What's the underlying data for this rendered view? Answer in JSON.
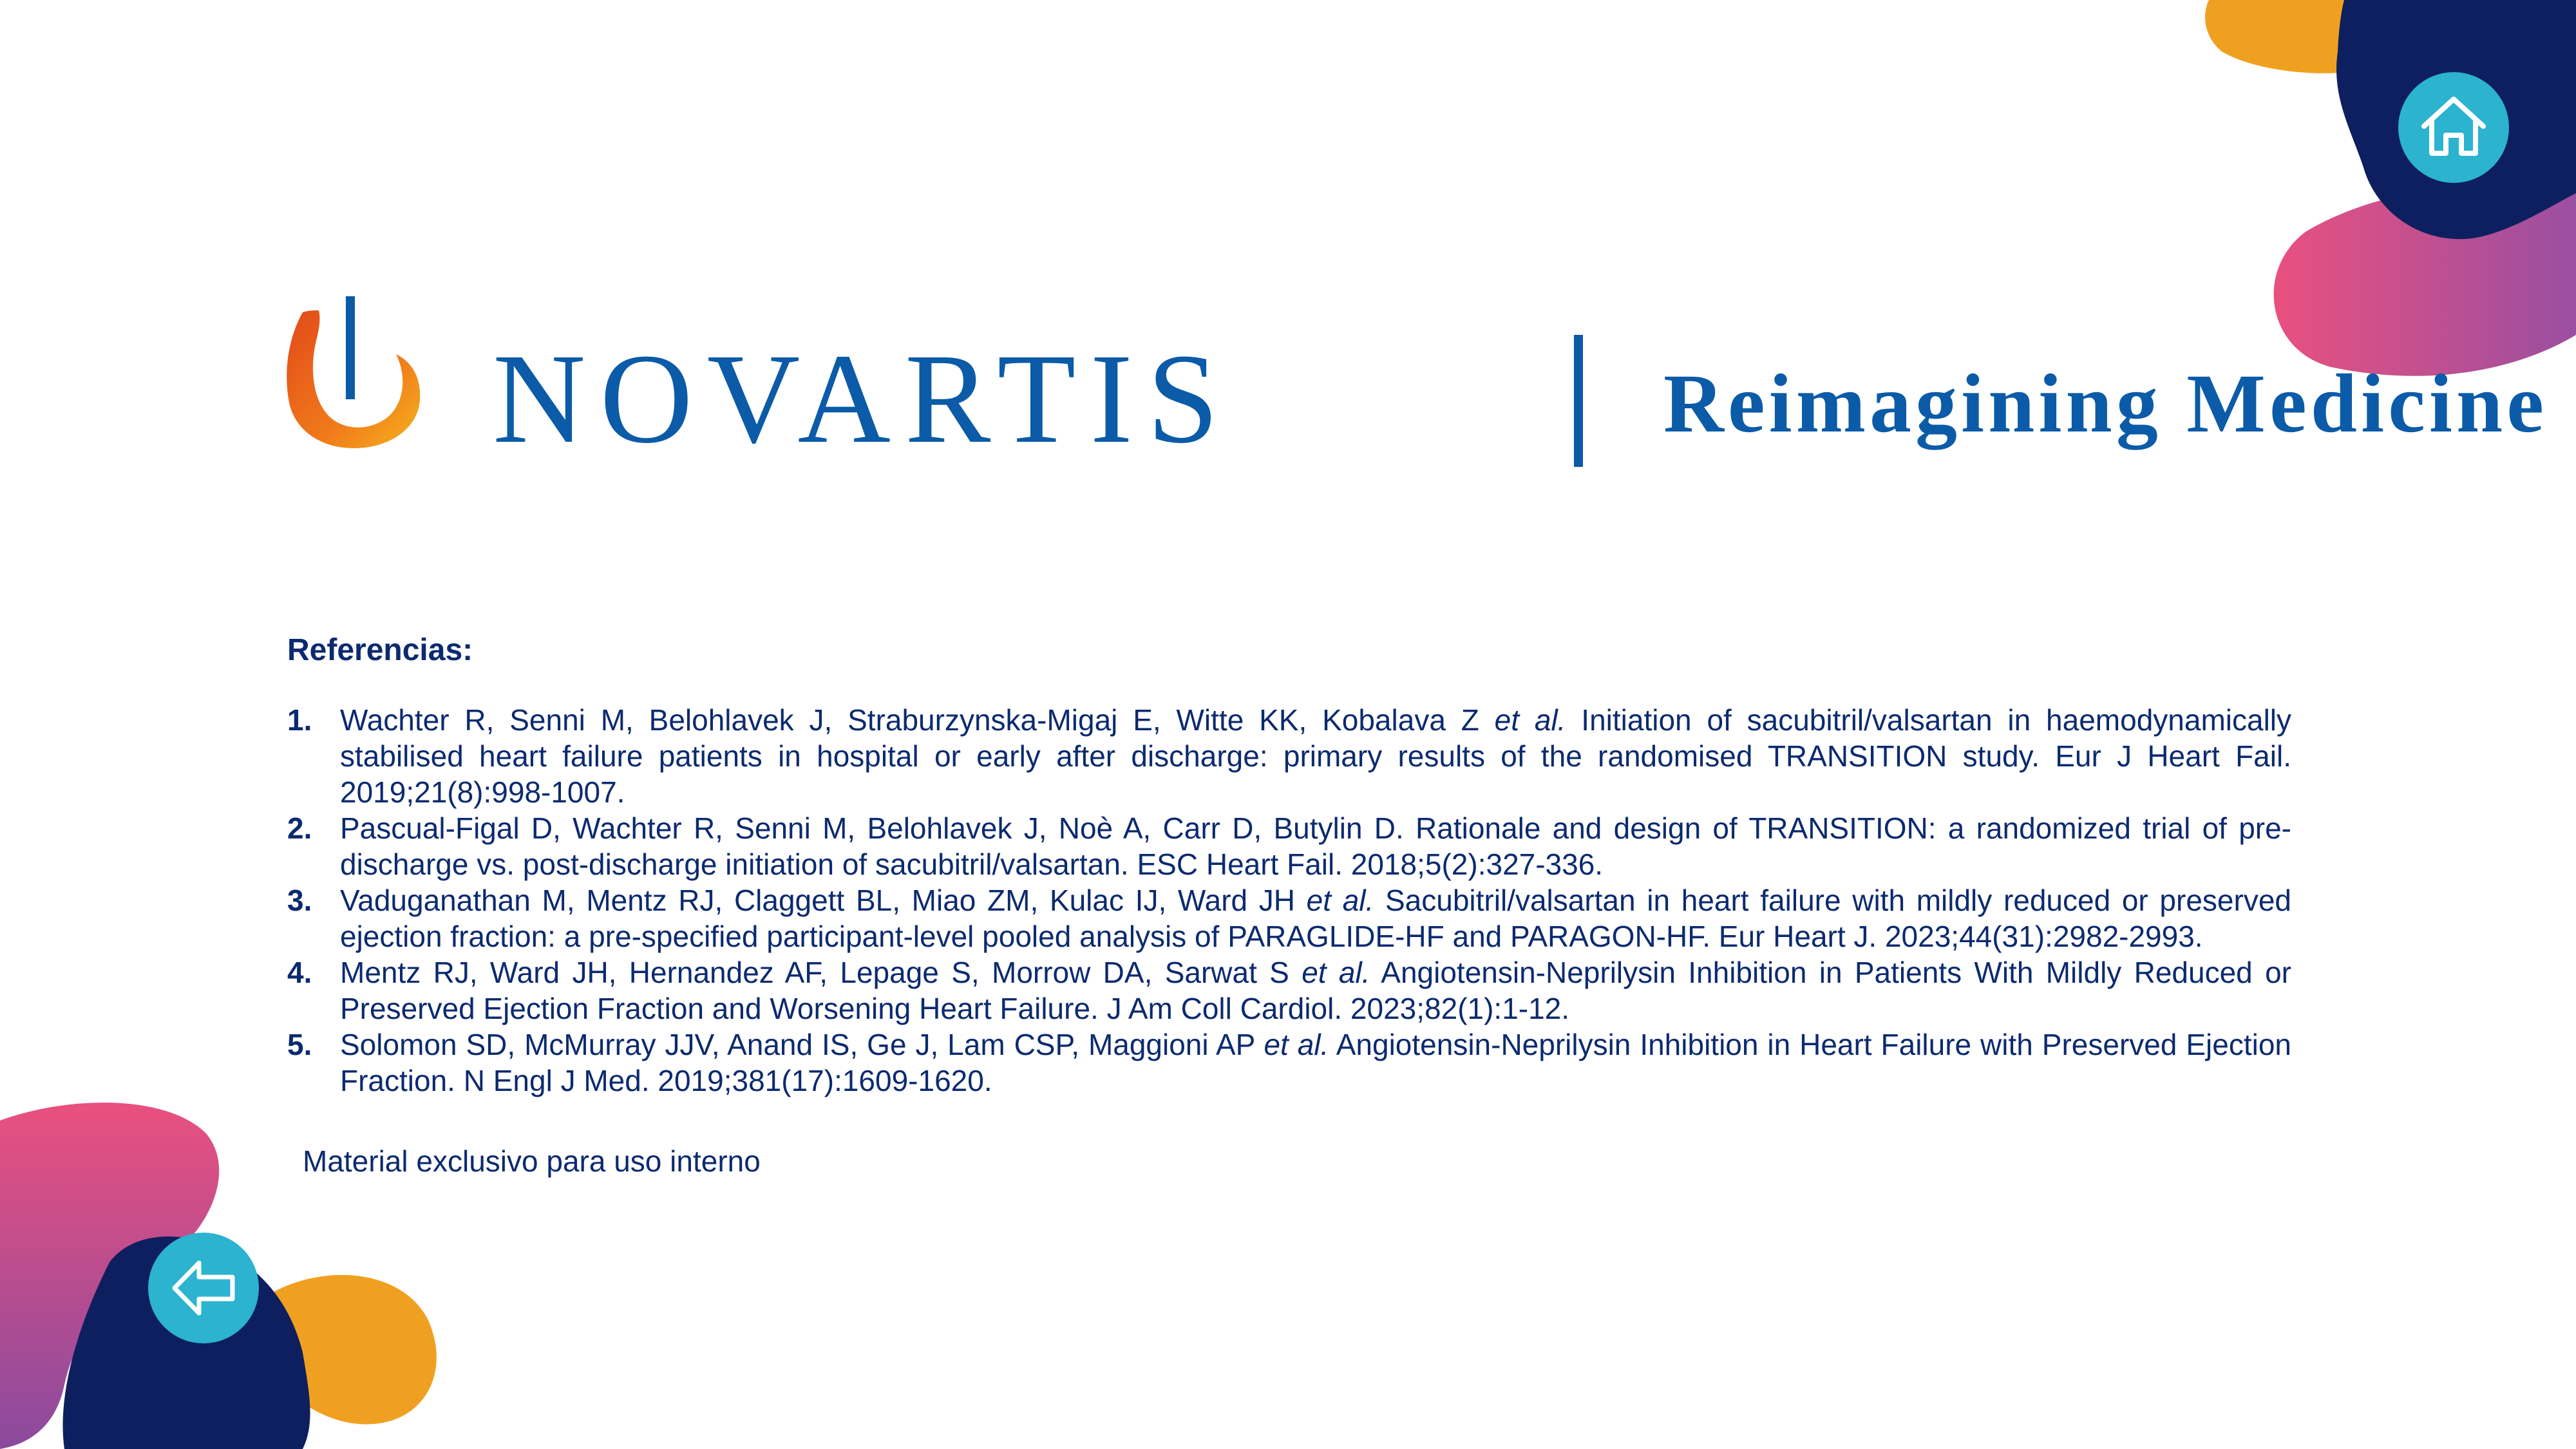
{
  "branding": {
    "wordmark": "NOVARTIS",
    "tagline": "Reimagining Medicine",
    "colors": {
      "primary": "#0b5ba8",
      "text": "#0b2a6f",
      "orange": "#f0a020",
      "pink": "#e9507f",
      "navy": "#0e1f5f",
      "teal": "#2bb3d0"
    }
  },
  "references": {
    "title": "Referencias:",
    "items": [
      {
        "number": "1.",
        "authors": "Wachter R, Senni M, Belohlavek J, Straburzynska-Migaj E, Witte KK, Kobalava Z ",
        "etal": "et al.",
        "text": " Initiation of sacubitril/valsartan in haemodynamically stabilised heart failure patients in hospital or early after discharge: primary results of the randomised TRANSITION study. Eur J Heart Fail. 2019;21(8):998-1007."
      },
      {
        "number": "2.",
        "authors": "Pascual-Figal D, Wachter R, Senni M, Belohlavek J, Noè A, Carr D, Butylin D.",
        "etal": "",
        "text": " Rationale and design of TRANSITION: a randomized trial of pre-discharge vs. post-discharge initiation of sacubitril/valsartan. ESC Heart Fail. 2018;5(2):327-336."
      },
      {
        "number": "3.",
        "authors": "Vaduganathan M, Mentz RJ, Claggett BL, Miao ZM, Kulac IJ, Ward JH ",
        "etal": "et al.",
        "text": " Sacubitril/valsartan in heart failure with mildly reduced or preserved ejection fraction: a pre-specified participant-level pooled analysis of PARAGLIDE-HF and PARAGON-HF. Eur Heart J. 2023;44(31):2982-2993."
      },
      {
        "number": "4.",
        "authors": "Mentz RJ, Ward JH, Hernandez AF, Lepage S, Morrow DA, Sarwat S ",
        "etal": "et al.",
        "text": " Angiotensin-Neprilysin Inhibition in Patients With Mildly Reduced or Preserved Ejection Fraction and Worsening Heart Failure. J Am Coll Cardiol. 2023;82(1):1-12."
      },
      {
        "number": "5.",
        "authors": "Solomon SD, McMurray JJV, Anand IS, Ge J, Lam CSP, Maggioni AP ",
        "etal": "et al.",
        "text": " Angiotensin-Neprilysin Inhibition in Heart Failure with Preserved Ejection Fraction. N Engl J Med. 2019;381(17):1609-1620."
      }
    ]
  },
  "footer": {
    "note": "Material exclusivo para uso interno"
  },
  "nav": {
    "home_icon": "home-icon",
    "back_icon": "arrow-left-icon"
  }
}
